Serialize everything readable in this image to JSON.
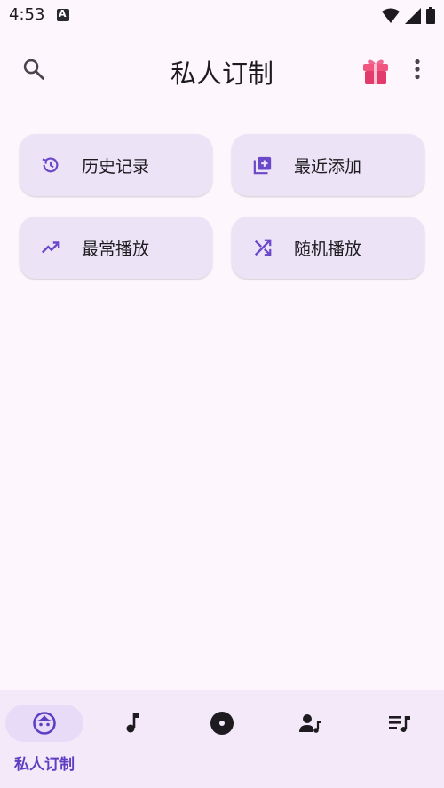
{
  "status_bar": {
    "time": "4:53"
  },
  "top_bar": {
    "title": "私人订制"
  },
  "tiles": [
    {
      "label": "历史记录",
      "icon": "history-icon"
    },
    {
      "label": "最近添加",
      "icon": "library-add-icon"
    },
    {
      "label": "最常播放",
      "icon": "trending-up-icon"
    },
    {
      "label": "随机播放",
      "icon": "shuffle-icon"
    }
  ],
  "bottom_nav": {
    "active_label": "私人订制",
    "items": [
      "face-icon",
      "music-note-icon",
      "album-icon",
      "artist-icon",
      "playlist-icon"
    ]
  },
  "colors": {
    "accent": "#5f3ec3",
    "tile_bg": "#ece4f6",
    "gift": "#e94a79",
    "background": "#fdf7fd"
  }
}
